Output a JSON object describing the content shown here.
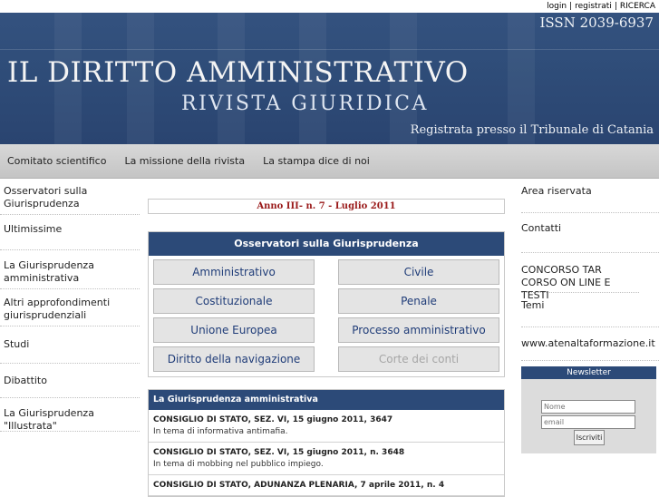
{
  "top_links": {
    "login": "login",
    "sep1": "|",
    "register": "registrati",
    "sep2": "|",
    "search": "RICERCA"
  },
  "header": {
    "issn": "ISSN 2039-6937",
    "title": "IL DIRITTO AMMINISTRATIVO",
    "subtitle": "RIVISTA GIURIDICA",
    "registration": "Registrata presso il Tribunale di Catania"
  },
  "nav": [
    "Comitato scientifico",
    "La missione della rivista",
    "La stampa dice di noi"
  ],
  "left_menu": [
    "Osservatori sulla Giurisprudenza",
    "Ultimissime",
    "La Giurisprudenza amministrativa",
    "Altri approfondimenti giurisprudenziali",
    "Studi",
    "Dibattito",
    "La Giurisprudenza \"Illustrata\""
  ],
  "issue": "Anno III- n. 7 - Luglio 2011",
  "observatories": {
    "title": "Osservatori sulla Giurisprudenza",
    "buttons": [
      "Amministrativo",
      "Civile",
      "Costituzionale",
      "Penale",
      "Unione Europea",
      "Processo amministrativo",
      "Diritto della navigazione",
      "Corte dei conti"
    ]
  },
  "jurisprudence": {
    "title": "La Giurisprudenza amministrativa",
    "entries": [
      {
        "title": "CONSIGLIO DI STATO, SEZ. VI, 15 giugno 2011, 3647",
        "desc": "In tema di informativa antimafia."
      },
      {
        "title": "CONSIGLIO DI STATO, SEZ. VI, 15 giugno 2011, n. 3648",
        "desc": "In tema di mobbing nel pubblico impiego."
      },
      {
        "title": "CONSIGLIO DI STATO, ADUNANZA PLENARIA, 7 aprile 2011, n. 4",
        "desc": ""
      }
    ]
  },
  "right_menu": [
    "Area riservata",
    "Contatti",
    "CONCORSO TAR CORSO ON LINE E TESTI",
    "Temi",
    "www.atenaltaformazione.it"
  ],
  "newsletter": {
    "title": "Newsletter",
    "name_placeholder": "Nome",
    "email_placeholder": "email",
    "submit": "Iscriviti"
  }
}
